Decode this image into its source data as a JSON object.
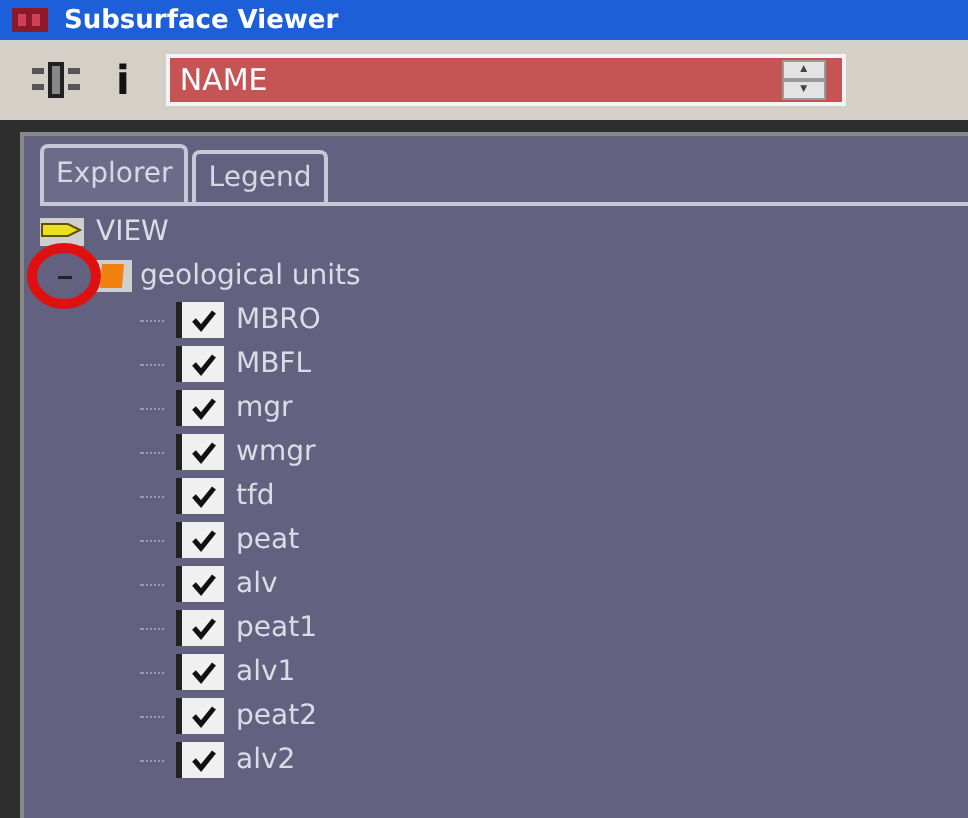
{
  "window": {
    "title": "Subsurface Viewer"
  },
  "toolbar": {
    "info_label": "i",
    "field": {
      "value": "NAME"
    },
    "spin_up": "▲",
    "spin_down": "▼"
  },
  "tabs": [
    {
      "label": "Explorer",
      "selected": true
    },
    {
      "label": "Legend",
      "selected": false
    }
  ],
  "tree": {
    "label": "VIEW",
    "children": [
      {
        "label": "geological units",
        "expanded": true,
        "highlighted": true,
        "children": [
          {
            "label": "MBRO",
            "checked": true
          },
          {
            "label": "MBFL",
            "checked": true
          },
          {
            "label": "mgr",
            "checked": true
          },
          {
            "label": "wmgr",
            "checked": true
          },
          {
            "label": "tfd",
            "checked": true
          },
          {
            "label": "peat",
            "checked": true
          },
          {
            "label": "alv",
            "checked": true
          },
          {
            "label": "peat1",
            "checked": true
          },
          {
            "label": "alv1",
            "checked": true
          },
          {
            "label": "peat2",
            "checked": true
          },
          {
            "label": "alv2",
            "checked": true
          }
        ]
      }
    ]
  }
}
